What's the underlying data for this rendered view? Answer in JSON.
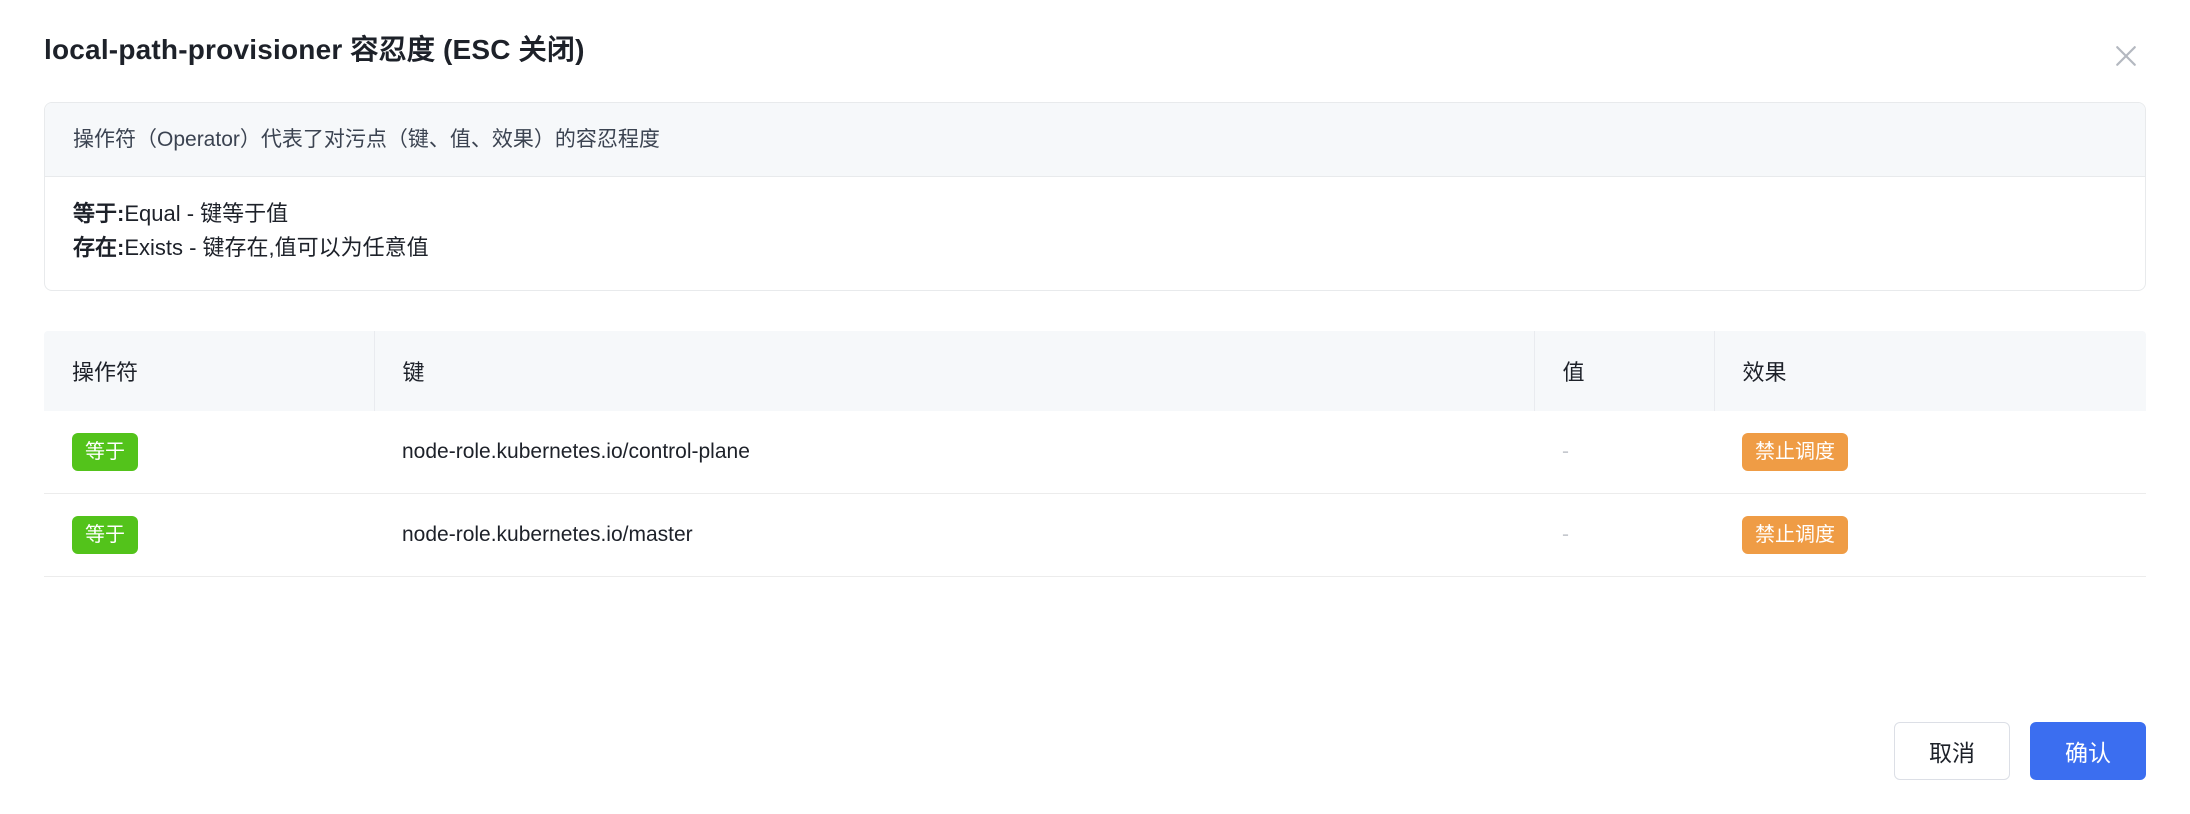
{
  "dialog": {
    "title": "local-path-provisioner 容忍度 (ESC 关闭)",
    "close_icon": "close-icon"
  },
  "info_panel": {
    "header": "操作符（Operator）代表了对污点（键、值、效果）的容忍程度",
    "lines": [
      {
        "term": "等于:",
        "desc": "Equal - 键等于值"
      },
      {
        "term": "存在:",
        "desc": "Exists - 键存在,值可以为任意值"
      }
    ]
  },
  "table": {
    "columns": [
      "操作符",
      "键",
      "值",
      "效果"
    ],
    "rows": [
      {
        "operator": "等于",
        "key": "node-role.kubernetes.io/control-plane",
        "value": "-",
        "effect": "禁止调度"
      },
      {
        "operator": "等于",
        "key": "node-role.kubernetes.io/master",
        "value": "-",
        "effect": "禁止调度"
      }
    ]
  },
  "footer": {
    "cancel_label": "取消",
    "confirm_label": "确认"
  },
  "colors": {
    "badge_green": "#53c31b",
    "badge_orange": "#ef9c45",
    "primary_blue": "#3b6ef0",
    "panel_header_bg": "#f6f8fa",
    "border": "#e8eaec"
  }
}
